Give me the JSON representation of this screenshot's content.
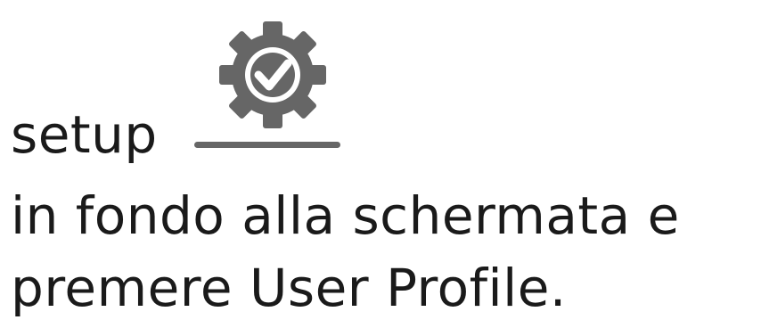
{
  "text": {
    "line1_word": "setup",
    "line2": "in fondo alla schermata e",
    "line3": "premere User Profile."
  },
  "icon": {
    "name": "setup-gear-check-icon",
    "color": "#666666"
  }
}
